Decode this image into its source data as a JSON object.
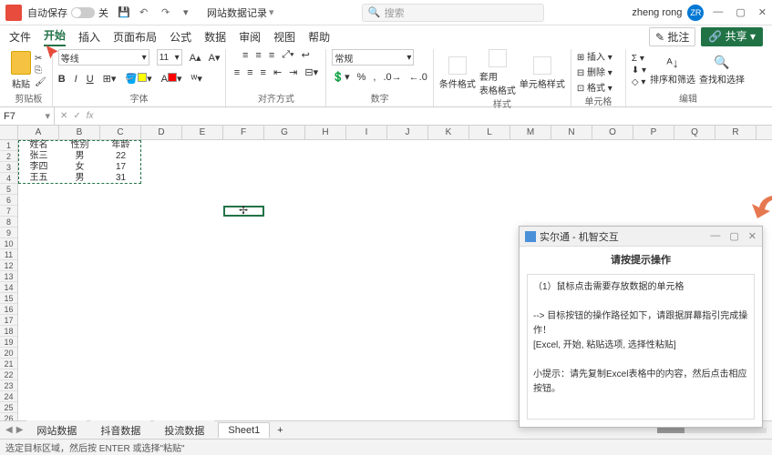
{
  "titlebar": {
    "autosave_label": "自动保存",
    "autosave_state": "关",
    "doc_name": "网站数据记录",
    "search_placeholder": "搜索",
    "user_name": "zheng rong",
    "user_initials": "ZR"
  },
  "menu": {
    "file": "文件",
    "home": "开始",
    "insert": "插入",
    "page_layout": "页面布局",
    "formulas": "公式",
    "data": "数据",
    "review": "审阅",
    "view": "视图",
    "help": "帮助",
    "comments": "批注",
    "share": "共享"
  },
  "ribbon": {
    "clipboard": "剪贴板",
    "paste": "粘贴",
    "font_group": "字体",
    "font_name": "等线",
    "font_size": "11",
    "alignment": "对齐方式",
    "number": "数字",
    "number_format": "常规",
    "styles": "样式",
    "cond_fmt": "条件格式",
    "table_fmt": "套用\n表格格式",
    "cell_style": "单元格样式",
    "cells": "单元格",
    "insert": "插入",
    "delete": "删除",
    "format": "格式",
    "editing": "编辑",
    "sort_filter": "排序和筛选",
    "find_select": "查找和选择"
  },
  "namebox": "F7",
  "columns": [
    "A",
    "B",
    "C",
    "D",
    "E",
    "F",
    "G",
    "H",
    "I",
    "J",
    "K",
    "L",
    "M",
    "N",
    "O",
    "P",
    "Q",
    "R"
  ],
  "rows": [
    "1",
    "2",
    "3",
    "4",
    "5",
    "6",
    "7",
    "8",
    "9",
    "10",
    "11",
    "12",
    "13",
    "14",
    "15",
    "16",
    "17",
    "18",
    "19",
    "20",
    "21",
    "22",
    "23",
    "24",
    "25",
    "26"
  ],
  "data_cells": {
    "A1": "姓名",
    "B1": "性别",
    "C1": "年龄",
    "A2": "张三",
    "B2": "男",
    "C2": "22",
    "A3": "李四",
    "B3": "女",
    "C3": "17",
    "A4": "王五",
    "B4": "男",
    "C4": "31"
  },
  "sheets": {
    "s1": "网站数据",
    "s2": "抖音数据",
    "s3": "投流数据",
    "s4": "Sheet1"
  },
  "statusbar": "选定目标区域，然后按 ENTER 或选择\"粘贴\"",
  "dialog": {
    "title": "实尔通 - 机智交互",
    "heading": "请按提示操作",
    "line1": "（1）鼠标点击需要存放数据的单元格",
    "line2": "--> 目标按钮的操作路径如下，请跟据屏幕指引完成操作！",
    "line3": "[Excel, 开始, 粘贴选项, 选择性粘贴]",
    "line4": "小提示：请先复制Excel表格中的内容，然后点击相应按钮。"
  }
}
